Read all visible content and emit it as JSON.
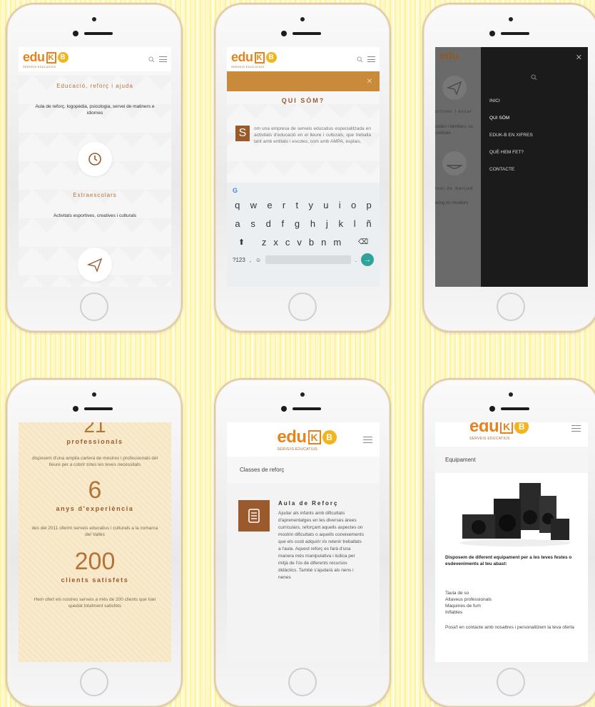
{
  "brand": {
    "logo_edu": "edu",
    "logo_k": "K",
    "logo_b": "B",
    "logo_sub": "SERVEIS EDUCATIUS",
    "accent": "#e8821a",
    "brown": "#9a5a2b"
  },
  "phone1": {
    "tagline": "Educació, reforç i ajuda",
    "intro": "Aula de reforç, logopèdia, psicologia, servei de matiners e idiomes",
    "service_title": "Extraescolars",
    "service_desc": "Activitats esportives, creatives i culturals"
  },
  "phone2": {
    "search_placeholder": "",
    "page_title": "QUI SÓM?",
    "dropcap": "S",
    "body": "om una empresa de serveis educatius especialitzada en activitats d'educació en el lleure i culturals, que treballa tant amb entitats i escoles, com amb AMPA, esplais,",
    "keyboard": {
      "row1": [
        "q",
        "w",
        "e",
        "r",
        "t",
        "y",
        "u",
        "i",
        "o",
        "p"
      ],
      "row2": [
        "a",
        "s",
        "d",
        "f",
        "g",
        "h",
        "j",
        "k",
        "l",
        "ñ"
      ],
      "row3": [
        "z",
        "x",
        "c",
        "v",
        "b",
        "n",
        "m"
      ],
      "num_key": "?123",
      "comma": ",",
      "period": "."
    }
  },
  "phone3": {
    "menu_items": [
      "INICI",
      "QUI SÓM",
      "EDUK-B EN XIFRES",
      "QUÈ HEM FET?",
      "CONTACTE"
    ],
    "bg_text1": "ortives i escur",
    "bg_text2": "colars i familiars, co colònies",
    "bg_text3": "rvei de menjad",
    "bg_text4": "ering i/o monitors"
  },
  "phone4": {
    "top_number": "21",
    "stats": [
      {
        "title": "professionals",
        "desc": "disposem d'una amplia cartera de mestres i professionals del lleure per a cobrir totes les teves necessitats"
      },
      {
        "number": "6",
        "title": "anys d'experiència",
        "desc": "des del 2011 oferint serveis educatius i culturals a la comarca del Vallès"
      },
      {
        "number": "200",
        "title": "clients satisfets",
        "desc": "Hem ofert els nostres serveis a més de 200 clients que han quedat totalment satisfets"
      }
    ]
  },
  "phone5": {
    "section": "Classes de reforç",
    "card_title": "Aula de Reforç",
    "card_body": "Ajudar als infants amb dificultats d'aprenentatges en les diverses àrees curriculars, reforçant aquells aspectes on mostrin dificultats o aquells coneixements que els costi adquirir i/o retenir treballats a l'aula. Aquest reforç es farà d'una manera més manipulativa i lúdica per mitjà de l'ús de diferents recursos didàctics. També s'ajudarà als nens i nenes"
  },
  "phone6": {
    "section": "Equipament",
    "lead": "Disposem de diferent equipament per a les teves festes o esdeveniments al teu abast:",
    "items": [
      "Taula de so",
      "Altaveus professionals",
      "Màquines de fum",
      "Inflables"
    ],
    "cta": "Posa't en contacte amb nosaltres i personalitzem la teva oferta"
  }
}
